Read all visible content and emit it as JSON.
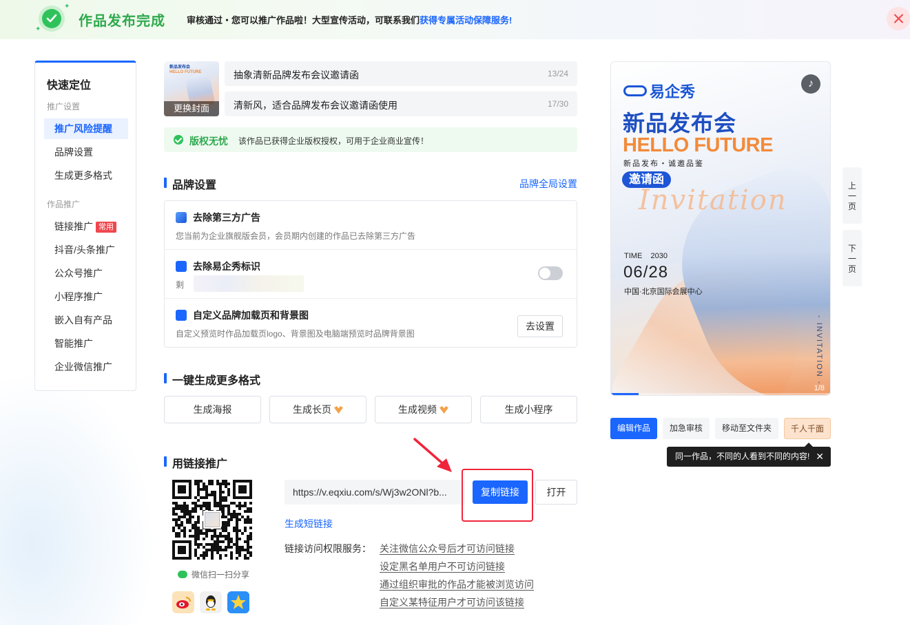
{
  "banner": {
    "title": "作品发布完成",
    "message": "审核通过・您可以推广作品啦！大型宣传活动，可联系我们",
    "message_link": "获得专属活动保障服务!"
  },
  "sidebar": {
    "title": "快速定位",
    "group1": "推广设置",
    "group1_items": [
      "推广风险提醒",
      "品牌设置",
      "生成更多格式"
    ],
    "group2": "作品推广",
    "group2_items": [
      "链接推广",
      "抖音/头条推广",
      "公众号推广",
      "小程序推广",
      "嵌入自有产品",
      "智能推广",
      "企业微信推广"
    ],
    "hot_tag": "常用"
  },
  "work": {
    "cover_label": "更换封面",
    "cover_mini_title": "新品发布会",
    "cover_mini_sub": "HELLO FUTURE",
    "title": "抽象清新品牌发布会议邀请函",
    "title_count": "13/24",
    "desc": "清新风，适合品牌发布会议邀请函使用",
    "desc_count": "17/30"
  },
  "copyright": {
    "label": "版权无忧",
    "desc": "该作品已获得企业版权授权，可用于企业商业宣传！"
  },
  "brand": {
    "section_title": "品牌设置",
    "global_link": "品牌全局设置",
    "rows": [
      {
        "name": "去除第三方广告",
        "sub": "您当前为企业旗舰版会员，会员期内创建的作品已去除第三方广告"
      },
      {
        "name": "去除易企秀标识",
        "sub": "剩"
      },
      {
        "name": "自定义品牌加载页和背景图",
        "sub": "自定义预览时作品加载页logo、背景图及电脑端预览时品牌背景图",
        "button": "去设置"
      }
    ],
    "toggle_on": false
  },
  "formats": {
    "section_title": "一键生成更多格式",
    "buttons": [
      "生成海报",
      "生成长页",
      "生成视频",
      "生成小程序"
    ]
  },
  "link_promo": {
    "section_title": "用链接推广",
    "url": "https://v.eqxiu.com/s/Wj3w2ONl?b...",
    "copy_button": "复制链接",
    "open_button": "打开",
    "short_link": "生成短链接",
    "perm_label": "链接访问权限服务：",
    "perm_links": [
      "关注微信公众号后才可访问链接",
      "设定黑名单用户不可访问链接",
      "通过组织审批的作品才能被浏览访问",
      "自定义某特征用户才可访问该链接"
    ],
    "wechat_share": "微信扫一扫分享",
    "social_icons": [
      "weibo-icon",
      "qq-icon",
      "qzone-icon"
    ]
  },
  "poster": {
    "brand": "易企秀",
    "headline": "新品发布会",
    "hello": "HELLO FUTURE",
    "tagline": "新品发布・诚邀品鉴",
    "pill": "邀请函",
    "script": "Invitation",
    "time_label": "TIME",
    "year": "2030",
    "date": "06/28",
    "place": "中国·北京国际会展中心",
    "vertical": "- INVITATION -",
    "page": "1/8",
    "progress": 0.125
  },
  "pager": {
    "prev": [
      "上",
      "一",
      "页"
    ],
    "next": [
      "下",
      "一",
      "页"
    ]
  },
  "actions": [
    "编辑作品",
    "加急审核",
    "移动至文件夹",
    "千人千面"
  ],
  "tip": {
    "text": "同一作品，不同的人看到不同的内容!",
    "close": "✕"
  },
  "colors": {
    "primary": "#1a66ff",
    "success": "#2fc25b",
    "danger": "#f0243a",
    "accent": "#f28a3a"
  }
}
